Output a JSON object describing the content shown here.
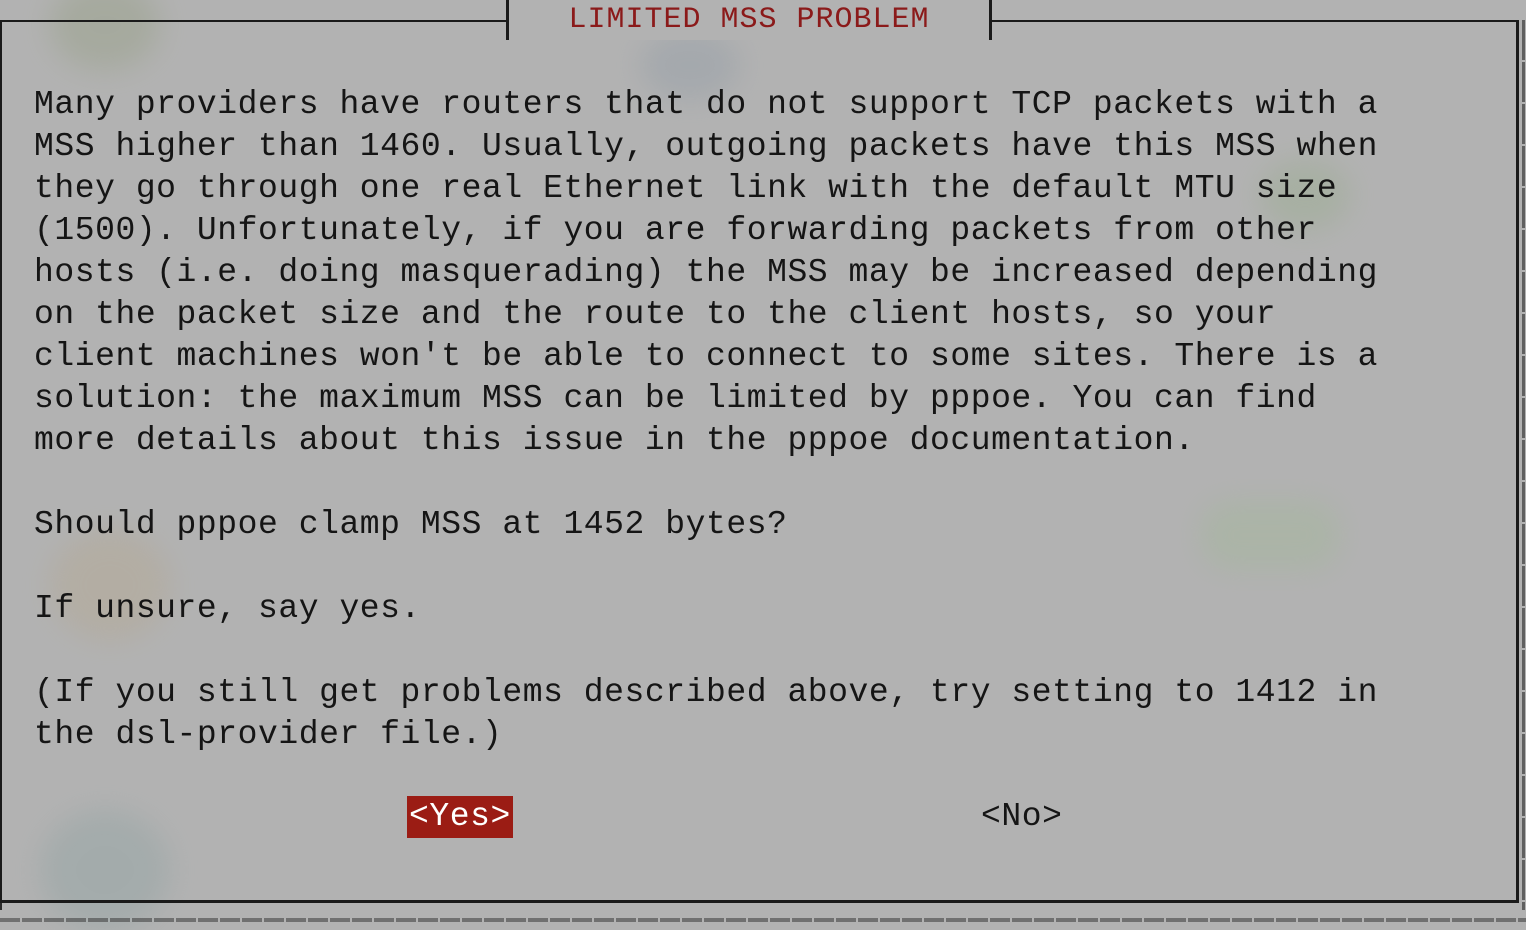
{
  "dialog": {
    "title": "LIMITED MSS PROBLEM",
    "body": "Many providers have routers that do not support TCP packets with a\nMSS higher than 1460. Usually, outgoing packets have this MSS when\nthey go through one real Ethernet link with the default MTU size\n(1500). Unfortunately, if you are forwarding packets from other\nhosts (i.e. doing masquerading) the MSS may be increased depending\non the packet size and the route to the client hosts, so your\nclient machines won't be able to connect to some sites. There is a\nsolution: the maximum MSS can be limited by pppoe. You can find\nmore details about this issue in the pppoe documentation.\n\nShould pppoe clamp MSS at 1452 bytes?\n\nIf unsure, say yes.\n\n(If you still get problems described above, try setting to 1412 in\nthe dsl-provider file.)",
    "buttons": {
      "yes_label": "<Yes>",
      "no_label": "<No>",
      "selected": "yes"
    }
  },
  "colors": {
    "background": "#b2b2b2",
    "title_text": "#8b1a1a",
    "selected_button_bg": "#9b1c14",
    "text": "#151515"
  }
}
